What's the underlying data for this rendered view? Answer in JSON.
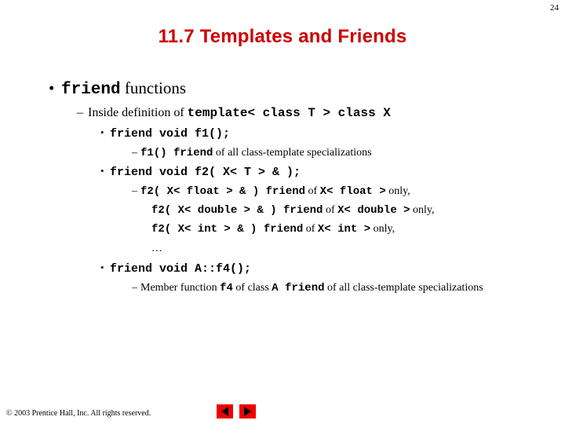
{
  "slide": {
    "page_number": "24",
    "title": "11.7  Templates and Friends",
    "title_color": "#cc0000"
  },
  "content": {
    "l1_bullet_marker": "•",
    "l2_dash_marker": "–",
    "l3_bullet_marker": "•",
    "l4_dash_marker": "–",
    "friend_keyword": "friend",
    "functions_word": "functions",
    "inside_definition_text": "Inside definition of ",
    "template_decl": "template< class T > class X",
    "f1_decl": "friend void f1();",
    "f1_note_code": "f1() friend",
    "f1_note_text": " of all class-template specializations",
    "f2_decl": "friend void f2( X< T > & );",
    "f2_float_code": "f2( X< float > & ) friend",
    "f2_float_of": " of ",
    "f2_float_type": "X< float >",
    "f2_float_only": " only,",
    "f2_double_code": "f2( X< double > & ) friend",
    "f2_double_of": " of ",
    "f2_double_type": "X< double >",
    "f2_double_only": " only,",
    "f2_int_code": "f2( X< int > & ) friend",
    "f2_int_of": " of ",
    "f2_int_type": "X< int >",
    "f2_int_only": " only,",
    "ellipsis": "…",
    "f4_decl": "friend void A::f4();",
    "f4_note_prefix": "Member function ",
    "f4_note_code1": "f4",
    "f4_note_mid": " of class ",
    "f4_note_code2": "A friend",
    "f4_note_suffix": " of all class-template specializations"
  },
  "footer": {
    "copyright": "© 2003 Prentice Hall, Inc.  All rights reserved.",
    "prev_label": "previous-slide",
    "next_label": "next-slide",
    "button_color": "#ee0000"
  }
}
